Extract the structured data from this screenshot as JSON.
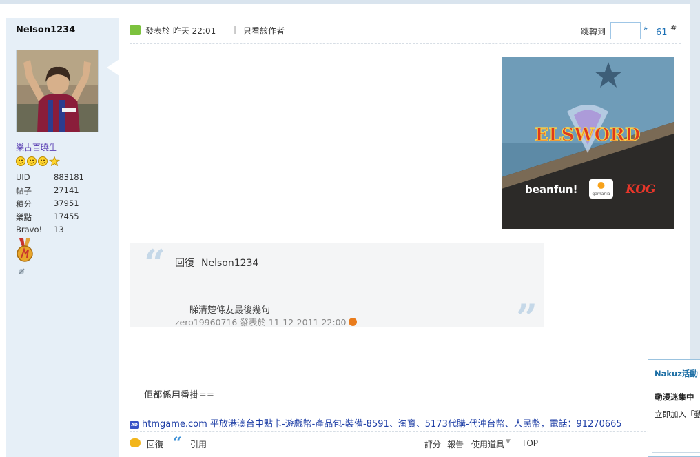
{
  "author": {
    "name": "Nelson1234",
    "rank_title": "樂古百曉生",
    "stats": [
      {
        "key": "UID",
        "value": "883181"
      },
      {
        "key": "帖子",
        "value": "27141"
      },
      {
        "key": "積分",
        "value": "37951"
      },
      {
        "key": "樂點",
        "value": "17455"
      },
      {
        "key": "Bravo!",
        "value": "13"
      }
    ]
  },
  "post_header": {
    "posted_label": "發表於  昨天 22:01",
    "separator": "|",
    "only_author": "只看該作者",
    "jump_label": "跳轉到",
    "jump_arrow": "»",
    "post_number": "61",
    "hash": "#"
  },
  "banner": {
    "brand": "beanfun!",
    "publisher": "gamania",
    "developer": "KOG",
    "logo_text": "ELSWORD"
  },
  "quote": {
    "reply_prefix": "回復",
    "reply_to": "Nelson1234",
    "text": "睇清楚條友最後幾句",
    "meta": "zero19960716 發表於 11-12-2011 22:00"
  },
  "post_body": "佢都係用番掛==",
  "ad": {
    "badge": "AD",
    "domain": "htmgame.com",
    "text": " 平放港澳台中點卡-遊戲幣-產品包-裝備-8591、淘寶、5173代購-代沖台幣、人民幣，電話：91270665"
  },
  "footer": {
    "reply": "回復",
    "quote": "引用",
    "rate": "評分",
    "report": "報告",
    "tools": "使用道具",
    "top": "TOP"
  },
  "popup": {
    "title": "Nakuz活動",
    "line1": "動漫迷集中",
    "line2": "立即加入「動"
  },
  "colors": {
    "sidebar_bg": "#e6eff7",
    "link_blue": "#1a6fb5",
    "rank_purple": "#5a3fb3",
    "ad_blue": "#1f3fa6"
  }
}
